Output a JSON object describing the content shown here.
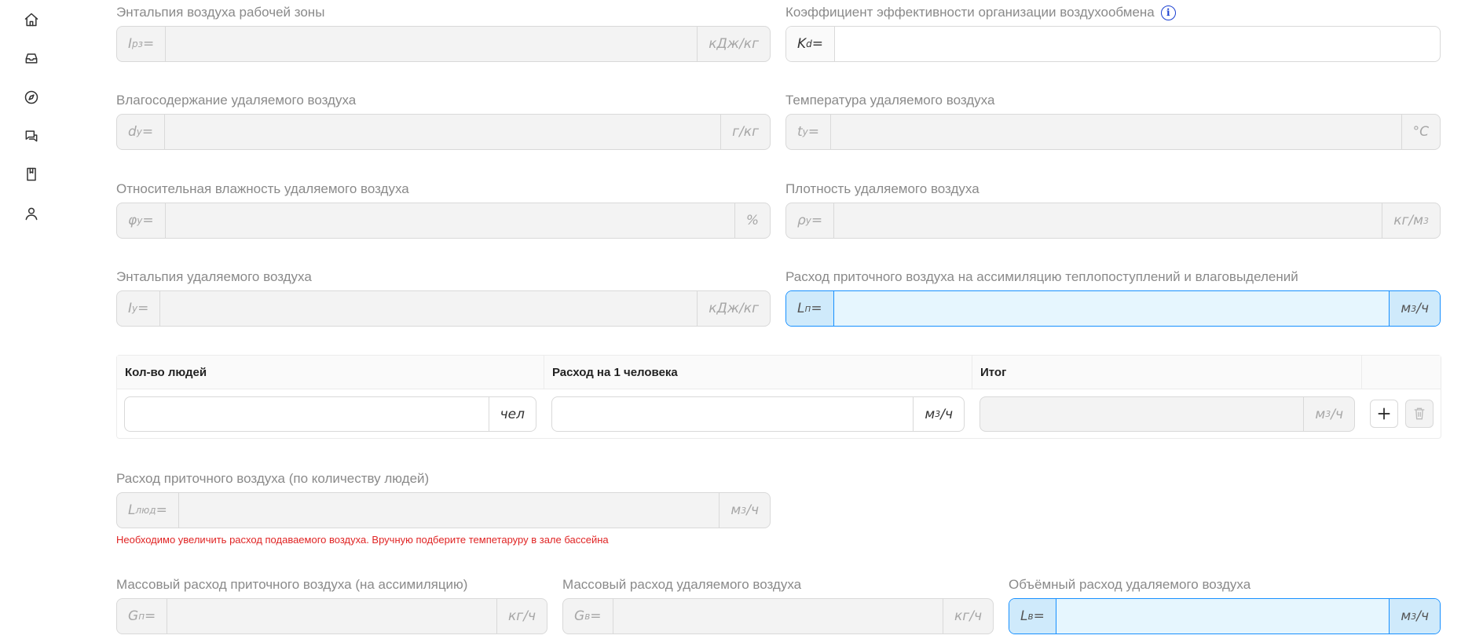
{
  "sidebar": {
    "icons": [
      "home-icon",
      "inbox-icon",
      "compass-icon",
      "chat-icon",
      "book-icon",
      "user-icon"
    ]
  },
  "fields": {
    "enthalpy_work_zone": {
      "label": "Энтальпия воздуха рабочей зоны",
      "prefix_main": "I",
      "prefix_sub": "рз",
      "prefix_eq": " =",
      "value": "",
      "suffix": "кДж/кг"
    },
    "efficiency_coef": {
      "label": "Коэффициент эффективности организации воздухообмена",
      "prefix_main": "K",
      "prefix_sub": "d",
      "prefix_eq": " =",
      "value": ""
    },
    "moisture_removed": {
      "label": "Влагосодержание удаляемого воздуха",
      "prefix_main": "d",
      "prefix_sub": "y",
      "prefix_eq": " =",
      "value": "",
      "suffix": "г/кг"
    },
    "temp_removed": {
      "label": "Температура удаляемого воздуха",
      "prefix_main": "t",
      "prefix_sub": "y",
      "prefix_eq": " =",
      "value": "",
      "suffix": "°C"
    },
    "humidity_removed": {
      "label": "Относительная влажность удаляемого воздуха",
      "prefix_main": "φ",
      "prefix_sub": "y",
      "prefix_eq": " =",
      "value": "",
      "suffix": "%"
    },
    "density_removed": {
      "label": "Плотность удаляемого воздуха",
      "prefix_main": "ρ",
      "prefix_sub": "y",
      "prefix_eq": " =",
      "value": "",
      "suffix_main": "кг/м",
      "suffix_sup": "3"
    },
    "enthalpy_removed": {
      "label": "Энтальпия удаляемого воздуха",
      "prefix_main": "I",
      "prefix_sub": "y",
      "prefix_eq": " =",
      "value": "",
      "suffix": "кДж/кг"
    },
    "supply_flow_assim": {
      "label": "Расход приточного воздуха на ассимиляцию теплопоступлений и влаговыделений",
      "prefix_main": "L",
      "prefix_sub": "п",
      "prefix_eq": " =",
      "value": "",
      "suffix_main": "м",
      "suffix_sup": "3",
      "suffix_tail": "/ч"
    },
    "supply_flow_people": {
      "label": "Расход приточного воздуха (по количеству людей)",
      "prefix_main": "L",
      "prefix_sub": "люд",
      "prefix_eq": " =",
      "value": "",
      "suffix_main": "м",
      "suffix_sup": "3",
      "suffix_tail": "/ч"
    },
    "mass_supply": {
      "label": "Массовый расход приточного воздуха (на ассимиляцию)",
      "prefix_main": "G",
      "prefix_sub": "п",
      "prefix_eq": " =",
      "value": "",
      "suffix": "кг/ч"
    },
    "mass_removed": {
      "label": "Массовый расход удаляемого воздуха",
      "prefix_main": "G",
      "prefix_sub": "в",
      "prefix_eq": " =",
      "value": "",
      "suffix": "кг/ч"
    },
    "volume_removed": {
      "label": "Объёмный расход удаляемого воздуха",
      "prefix_main": "L",
      "prefix_sub": "в",
      "prefix_eq": " =",
      "value": "",
      "suffix_main": "м",
      "suffix_sup": "3",
      "suffix_tail": "/ч"
    }
  },
  "people_table": {
    "headers": [
      "Кол-во людей",
      "Расход на 1 человека",
      "Итог"
    ],
    "row": {
      "count_value": "",
      "count_unit": "чел",
      "per_person_value": "",
      "per_person_unit_main": "м",
      "per_person_unit_sup": "3",
      "per_person_unit_tail": "/ч",
      "total_value": "",
      "total_unit_main": "м",
      "total_unit_sup": "3",
      "total_unit_tail": "/ч"
    }
  },
  "warning": "Необходимо увеличить расход подаваемого воздуха. Вручную подберите темпетаруру в зале бассейна",
  "colors": {
    "accent": "#1890ff",
    "accent_bg": "#e6f6fe",
    "error": "#e02424",
    "info": "#1a3fd1"
  }
}
